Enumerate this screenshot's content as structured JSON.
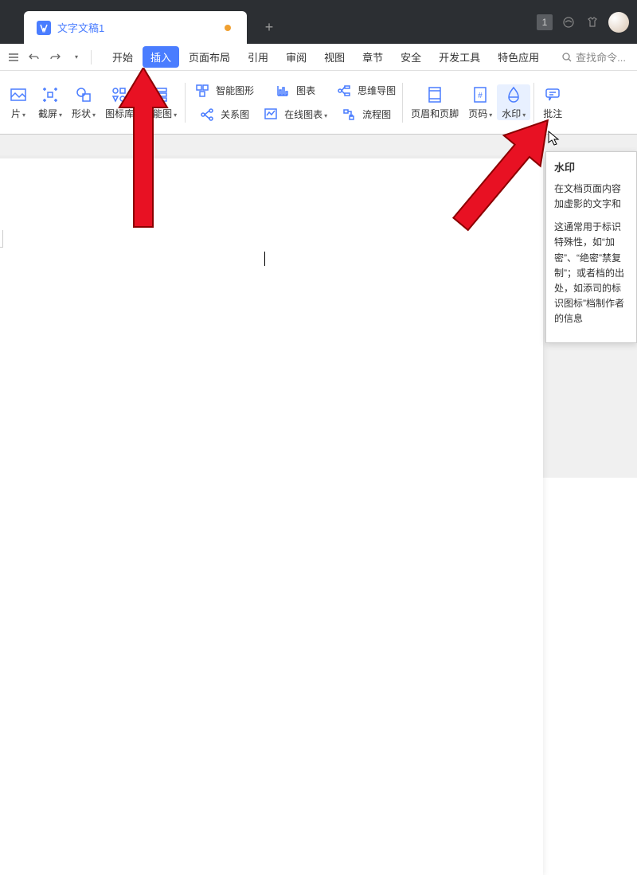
{
  "titlebar": {
    "tab_title": "文字文稿1",
    "badge": "1",
    "new_tab_icon": "+"
  },
  "menubar": {
    "tabs": [
      "开始",
      "插入",
      "页面布局",
      "引用",
      "审阅",
      "视图",
      "章节",
      "安全",
      "开发工具",
      "特色应用"
    ],
    "active_index": 1,
    "search_label": "查找命令..."
  },
  "ribbon": {
    "item_pics": "片",
    "screenshot": "截屏",
    "shape": "形状",
    "icon_lib": "图标库",
    "feature_chart": "功能图",
    "smart_graphic": "智能图形",
    "relation_chart": "关系图",
    "chart": "图表",
    "online_chart": "在线图表",
    "mindmap": "思维导图",
    "flowchart": "流程图",
    "header_footer": "页眉和页脚",
    "page_number": "页码",
    "watermark": "水印",
    "comment": "批注"
  },
  "tooltip": {
    "title": "水印",
    "p1": "在文档页面内容加虚影的文字和",
    "p2": "这通常用于标识特殊性，如“加密”、“绝密”禁复制”；或者档的出处，如添司的标识图标”档制作者的信息"
  }
}
